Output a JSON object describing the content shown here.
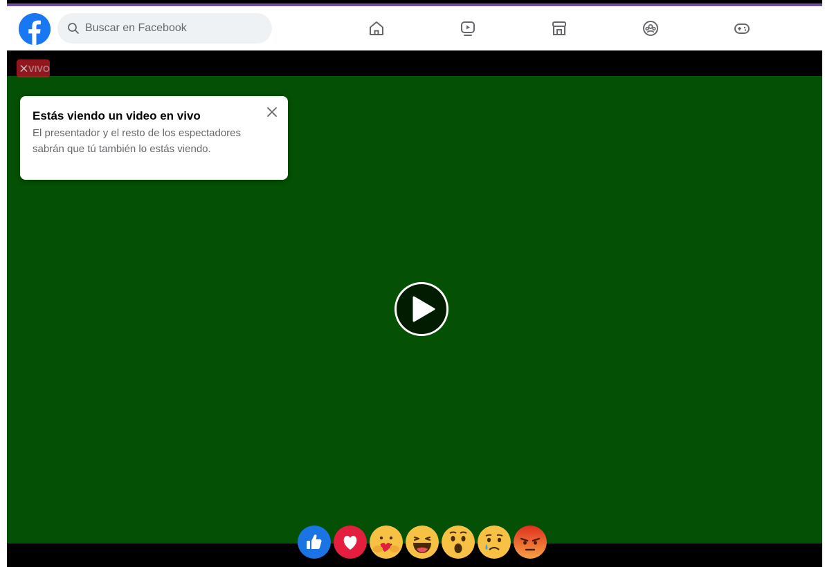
{
  "search": {
    "placeholder": "Buscar en Facebook"
  },
  "nav": {
    "items": [
      {
        "name": "home-icon",
        "label": ""
      },
      {
        "name": "watch-icon",
        "label": ""
      },
      {
        "name": "marketplace-icon",
        "label": ""
      },
      {
        "name": "groups-icon",
        "label": ""
      },
      {
        "name": "gaming-icon",
        "label": ""
      }
    ]
  },
  "live_badge": {
    "label": "VIVO",
    "icon": "close-icon"
  },
  "toast": {
    "title": "Estás viendo un video en vivo",
    "body": "El presentador y el resto de los espectadores sabrán que tú también lo estás viendo."
  },
  "player": {
    "background": "#045004",
    "play_icon": "play-icon"
  },
  "reactions": [
    "like",
    "love",
    "care",
    "haha",
    "wow",
    "sad",
    "angry"
  ],
  "colors": {
    "brand": "#1877f2",
    "live": "#c31e28",
    "video_bg": "#045004"
  }
}
